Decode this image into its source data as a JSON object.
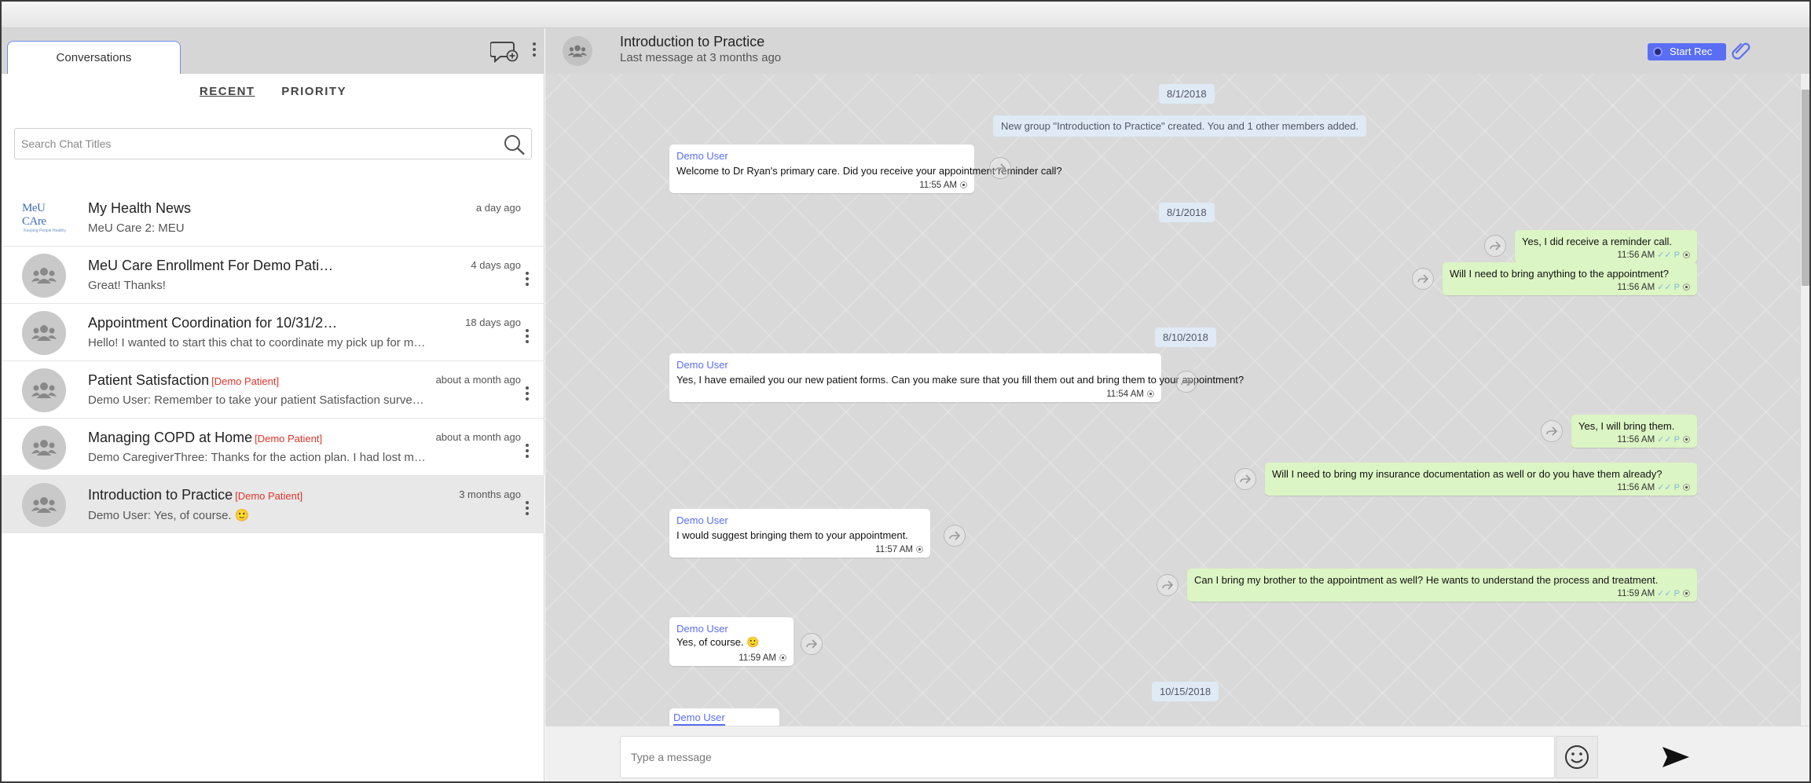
{
  "sidebar": {
    "tab_label": "Conversations",
    "filters": {
      "recent": "RECENT",
      "priority": "PRIORITY"
    },
    "search_placeholder": "Search Chat Titles",
    "conversations": [
      {
        "title": "My Health News",
        "tag": "",
        "subtitle": "MeU Care 2: MEU",
        "time": "a day ago",
        "avatar": "meu-care-logo",
        "logo_text": "MeU CAre",
        "logo_sub": "Keeping People Healthy"
      },
      {
        "title": "MeU Care Enrollment For Demo Pati…",
        "tag": "",
        "subtitle": "Great! Thanks!",
        "time": "4 days ago",
        "avatar": "group-icon"
      },
      {
        "title": "Appointment Coordination for 10/31/2…",
        "tag": "",
        "subtitle": "Hello! I wanted to start this chat to coordinate my pick up for m…",
        "time": "18 days ago",
        "avatar": "group-icon"
      },
      {
        "title": "Patient Satisfaction",
        "tag": "[Demo Patient]",
        "subtitle": "Demo User: Remember to take your patient Satisfaction surve…",
        "time": "about a month ago",
        "avatar": "group-icon"
      },
      {
        "title": "Managing COPD at Home",
        "tag": "[Demo Patient]",
        "subtitle": "Demo CaregiverThree: Thanks for the action plan. I had lost m…",
        "time": "about a month ago",
        "avatar": "group-icon"
      },
      {
        "title": "Introduction to Practice",
        "tag": "[Demo Patient]",
        "subtitle": "Demo User: Yes, of course. 🙂",
        "time": "3 months ago",
        "avatar": "group-icon",
        "selected": true
      }
    ]
  },
  "chat": {
    "title": "Introduction to Practice",
    "subtitle": "Last message at 3 months ago",
    "record_label": "Start Rec",
    "system_message": "New group \"Introduction to Practice\" created. You and 1 other members added.",
    "dates": [
      "8/1/2018",
      "8/1/2018",
      "8/10/2018",
      "10/15/2018"
    ],
    "messages": [
      {
        "dir": "in",
        "sender": "Demo User",
        "text": "Welcome to Dr Ryan's primary care. Did you receive your appointment reminder call?",
        "time": "11:55 AM"
      },
      {
        "dir": "out",
        "text": "Yes, I did receive a reminder call.",
        "time": "11:56 AM",
        "receipt": "✓✓ P"
      },
      {
        "dir": "out",
        "text": "Will I need to bring anything to the appointment?",
        "time": "11:56 AM",
        "receipt": "✓✓ P"
      },
      {
        "dir": "in",
        "sender": "Demo User",
        "text": "Yes, I have emailed you our new patient forms. Can you make sure that you fill them out and bring them to your appointment?",
        "time": "11:54 AM"
      },
      {
        "dir": "out",
        "text": "Yes, I will bring them.",
        "time": "11:56 AM",
        "receipt": "✓✓ P"
      },
      {
        "dir": "out",
        "text": "Will I need to bring my insurance documentation as well or do you have them already?",
        "time": "11:56 AM",
        "receipt": "✓✓ P"
      },
      {
        "dir": "in",
        "sender": "Demo User",
        "text": "I would suggest bringing them to your appointment.",
        "time": "11:57 AM"
      },
      {
        "dir": "out",
        "text": "Can I bring my brother to the appointment as well? He wants to understand the process and treatment.",
        "time": "11:59 AM",
        "receipt": "✓✓ P"
      },
      {
        "dir": "in",
        "sender": "Demo User",
        "text": "Yes, of course. 🙂",
        "time": "11:59 AM"
      },
      {
        "dir": "in",
        "sender": "Demo User",
        "text": "",
        "time": ""
      }
    ]
  },
  "composer": {
    "placeholder": "Type a message"
  },
  "colors": {
    "accent": "#5a6ef4",
    "outgoing_bubble": "#dcf5c4",
    "tag_red": "#e0342a",
    "header_gray": "#d6d6d6"
  }
}
